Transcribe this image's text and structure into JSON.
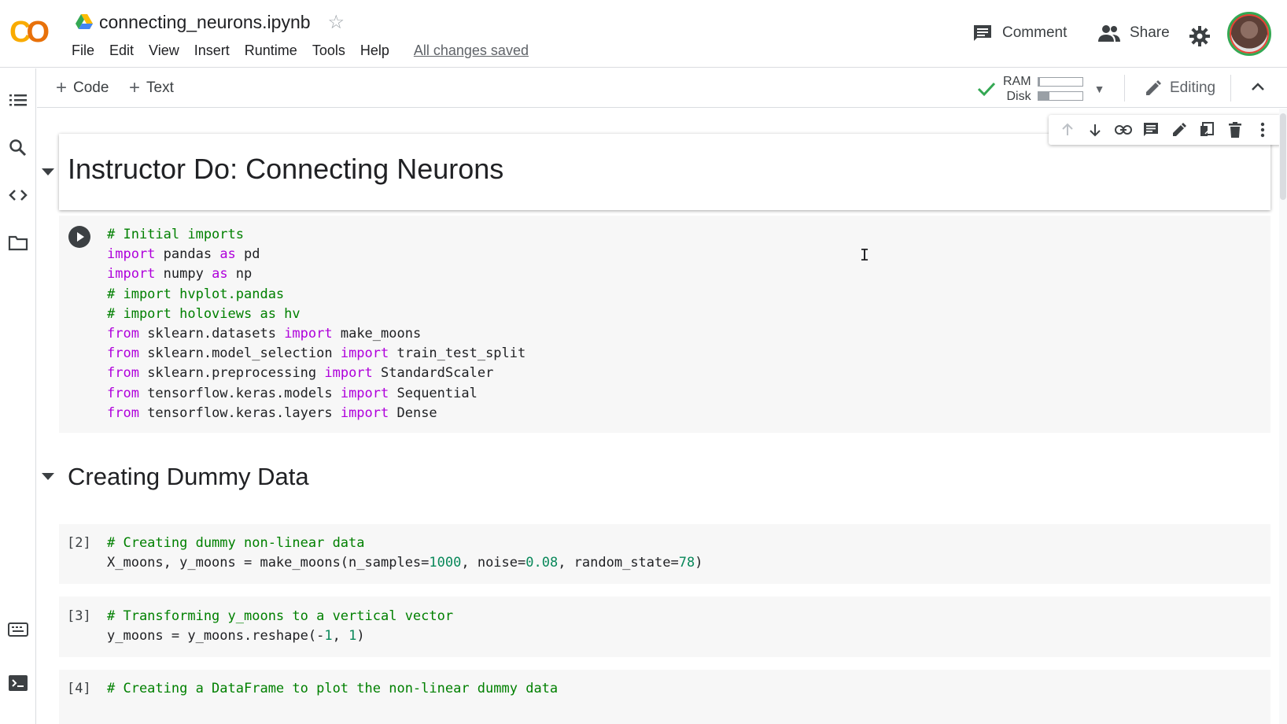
{
  "app": {
    "logo_text": [
      "C",
      "O"
    ],
    "title": "connecting_neurons.ipynb",
    "menu": [
      "File",
      "Edit",
      "View",
      "Insert",
      "Runtime",
      "Tools",
      "Help"
    ],
    "save_status": "All changes saved",
    "comment_label": "Comment",
    "share_label": "Share"
  },
  "toolbar": {
    "add_code_label": "Code",
    "add_text_label": "Text",
    "ram_label": "RAM",
    "disk_label": "Disk",
    "ram_usage": 0.05,
    "disk_usage": 0.25,
    "mode_label": "Editing"
  },
  "colors": {
    "comment": "#008000",
    "keyword": "#af00db",
    "number": "#09885a",
    "connected_check": "#34a853"
  },
  "cells": {
    "heading1": "Instructor Do: Connecting Neurons",
    "heading2": "Creating Dummy Data",
    "code1_lines": [
      [
        [
          "c",
          "# Initial imports"
        ]
      ],
      [
        [
          "k",
          "import"
        ],
        [
          "",
          " pandas "
        ],
        [
          "k",
          "as"
        ],
        [
          "",
          " pd"
        ]
      ],
      [
        [
          "k",
          "import"
        ],
        [
          "",
          " numpy "
        ],
        [
          "k",
          "as"
        ],
        [
          "",
          " np"
        ]
      ],
      [
        [
          "c",
          "# import hvplot.pandas"
        ]
      ],
      [
        [
          "c",
          "# import holoviews as hv"
        ]
      ],
      [
        [
          "k",
          "from"
        ],
        [
          "",
          " sklearn.datasets "
        ],
        [
          "k",
          "import"
        ],
        [
          "",
          " make_moons"
        ]
      ],
      [
        [
          "k",
          "from"
        ],
        [
          "",
          " sklearn.model_selection "
        ],
        [
          "k",
          "import"
        ],
        [
          "",
          " train_test_split"
        ]
      ],
      [
        [
          "k",
          "from"
        ],
        [
          "",
          " sklearn.preprocessing "
        ],
        [
          "k",
          "import"
        ],
        [
          "",
          " StandardScaler"
        ]
      ],
      [
        [
          "k",
          "from"
        ],
        [
          "",
          " tensorflow.keras.models "
        ],
        [
          "k",
          "import"
        ],
        [
          "",
          " Sequential"
        ]
      ],
      [
        [
          "k",
          "from"
        ],
        [
          "",
          " tensorflow.keras.layers "
        ],
        [
          "k",
          "import"
        ],
        [
          "",
          " Dense"
        ]
      ]
    ],
    "code2_count": "[2]",
    "code2_lines": [
      [
        [
          "c",
          "# Creating dummy non-linear data"
        ]
      ],
      [
        [
          "",
          "X_moons, y_moons = make_moons(n_samples="
        ],
        [
          "n",
          "1000"
        ],
        [
          "",
          ", noise="
        ],
        [
          "n",
          "0.08"
        ],
        [
          "",
          ", random_state="
        ],
        [
          "n",
          "78"
        ],
        [
          "",
          ")"
        ]
      ]
    ],
    "code3_count": "[3]",
    "code3_lines": [
      [
        [
          "c",
          "# Transforming y_moons to a vertical vector"
        ]
      ],
      [
        [
          "",
          "y_moons = y_moons.reshape(-"
        ],
        [
          "n",
          "1"
        ],
        [
          "",
          ", "
        ],
        [
          "n",
          "1"
        ],
        [
          "",
          ")"
        ]
      ]
    ],
    "code4_count": "[4]",
    "code4_lines": [
      [
        [
          "c",
          "# Creating a DataFrame to plot the non-linear dummy data"
        ]
      ]
    ]
  }
}
